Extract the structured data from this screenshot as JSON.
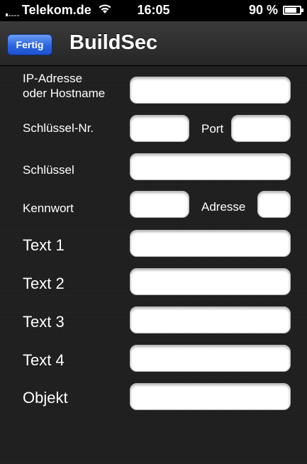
{
  "status_bar": {
    "carrier": "Telekom.de",
    "time": "16:05",
    "battery_text": "90 %",
    "battery_level": 0.9,
    "wifi_icon": "wifi-icon",
    "signal_icon": "signal-icon",
    "battery_icon": "battery-icon"
  },
  "nav_bar": {
    "done_label": "Fertig",
    "title": "BuildSec"
  },
  "colors": {
    "accent_button": "#2b65e2",
    "background": "#1f1f1f"
  },
  "form": {
    "ip_label_line1": "IP-Adresse",
    "ip_label_line2": "oder Hostname",
    "ip_value": "",
    "key_number_label": "Schlüssel-Nr.",
    "key_number_value": "",
    "port_label": "Port",
    "port_value": "",
    "key_label": "Schlüssel",
    "key_value": "",
    "password_label": "Kennwort",
    "password_value": "",
    "address_label": "Adresse",
    "address_value": "",
    "text1_label": "Text 1",
    "text1_value": "",
    "text2_label": "Text 2",
    "text2_value": "",
    "text3_label": "Text 3",
    "text3_value": "",
    "text4_label": "Text 4",
    "text4_value": "",
    "object_label": "Objekt",
    "object_value": ""
  }
}
